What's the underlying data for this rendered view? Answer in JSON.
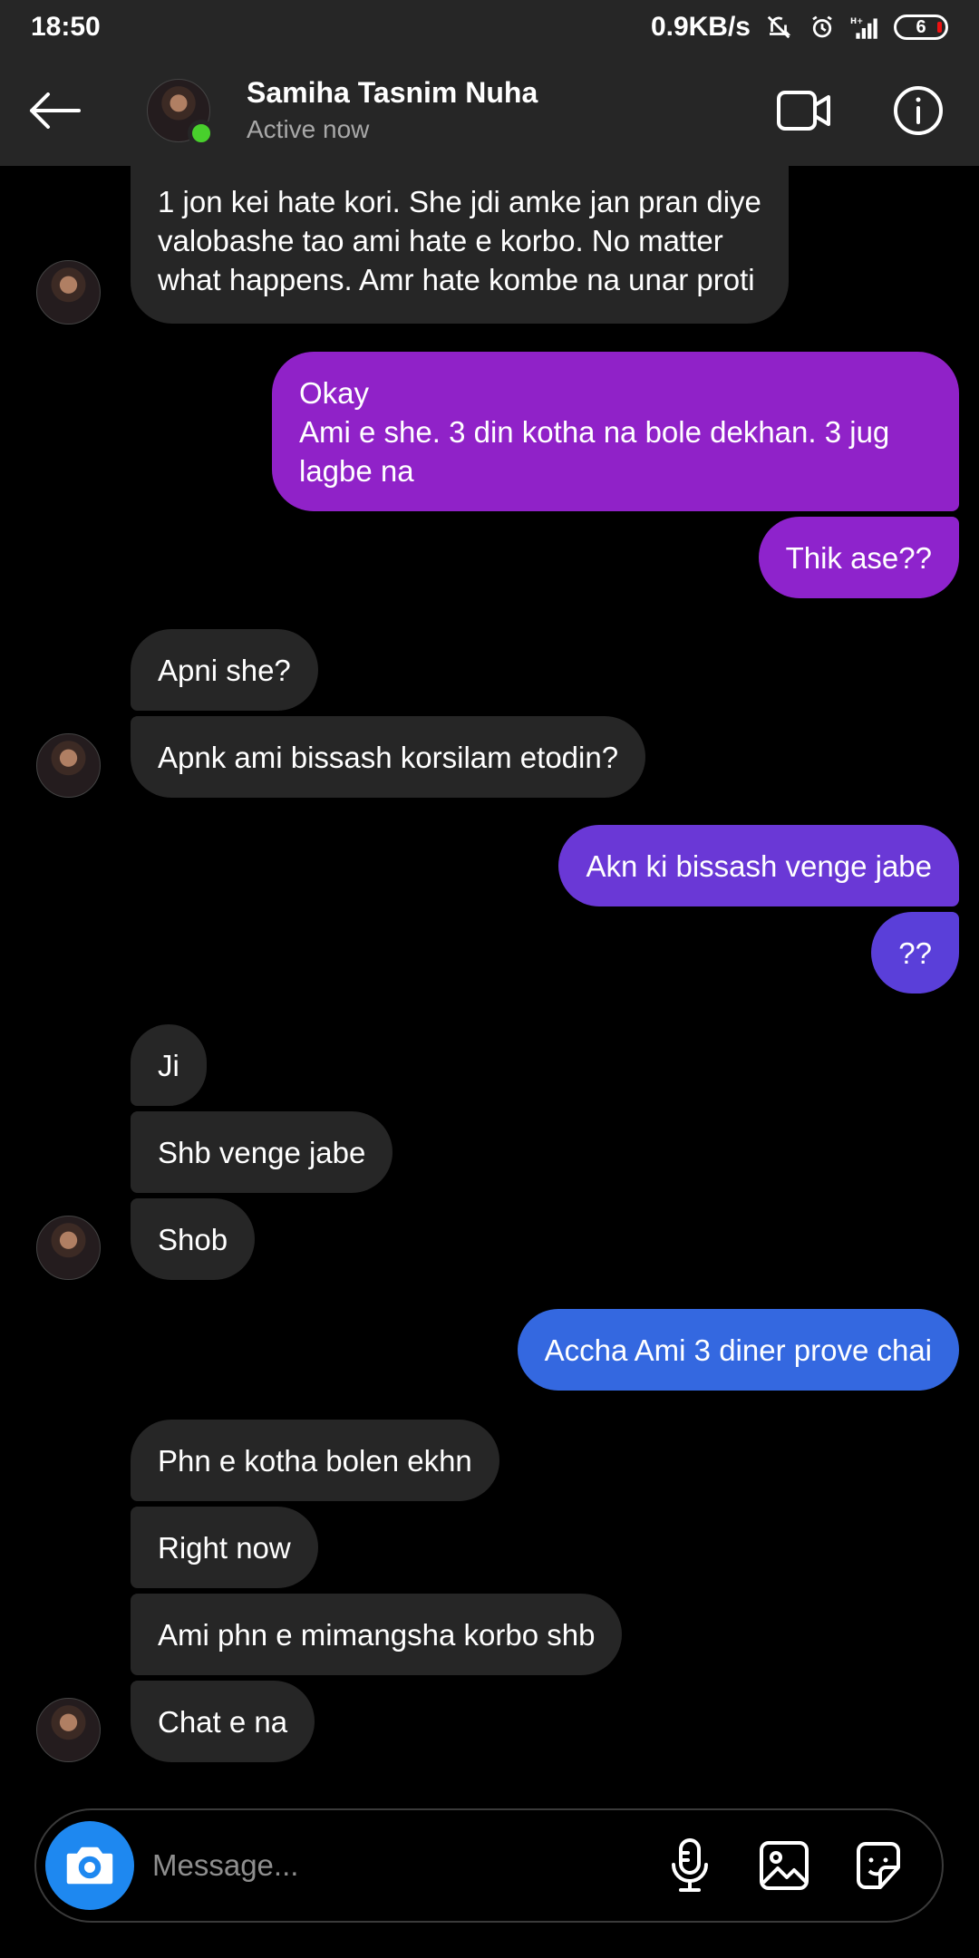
{
  "status_bar": {
    "time": "18:50",
    "network_speed": "0.9KB/s",
    "battery_level": "6",
    "icons": [
      "mute-icon",
      "alarm-icon",
      "signal-icon",
      "battery-icon"
    ]
  },
  "header": {
    "contact_name": "Samiha Tasnim Nuha",
    "status": "Active now",
    "online_indicator_color": "#48d02c"
  },
  "messages": [
    {
      "side": "incoming",
      "lines": [
        "1 jon kei hate kori. She jdi amke jan pran diye",
        "valobashe tao ami hate e korbo. No matter",
        "what happens. Amr hate kombe na unar proti"
      ]
    },
    {
      "side": "outgoing",
      "lines": [
        "Okay",
        "Ami e she. 3 din kotha na bole dekhan. 3 jug",
        "lagbe na"
      ]
    },
    {
      "side": "outgoing",
      "lines": [
        "Thik ase??"
      ]
    },
    {
      "side": "incoming",
      "lines": [
        "Apni she?"
      ]
    },
    {
      "side": "incoming",
      "lines": [
        "Apnk ami bissash korsilam etodin?"
      ]
    },
    {
      "side": "outgoing",
      "lines": [
        "Akn ki bissash venge jabe"
      ]
    },
    {
      "side": "outgoing",
      "lines": [
        "??"
      ]
    },
    {
      "side": "incoming",
      "lines": [
        "Ji"
      ]
    },
    {
      "side": "incoming",
      "lines": [
        "Shb venge jabe"
      ]
    },
    {
      "side": "incoming",
      "lines": [
        "Shob"
      ]
    },
    {
      "side": "outgoing",
      "lines": [
        "Accha Ami 3 diner prove chai"
      ]
    },
    {
      "side": "incoming",
      "lines": [
        "Phn e kotha bolen ekhn"
      ]
    },
    {
      "side": "incoming",
      "lines": [
        "Right now"
      ]
    },
    {
      "side": "incoming",
      "lines": [
        "Ami phn e mimangsha korbo shb"
      ]
    },
    {
      "side": "incoming",
      "lines": [
        "Chat e na"
      ]
    }
  ],
  "composer": {
    "placeholder": "Message...",
    "camera_button_color": "#1e88f0"
  },
  "colors": {
    "incoming_bubble": "#262626",
    "outgoing_gradient_top": "#9022c8",
    "outgoing_gradient_mid": "#5a3fd9",
    "outgoing_gradient_bottom": "#3468e0"
  }
}
